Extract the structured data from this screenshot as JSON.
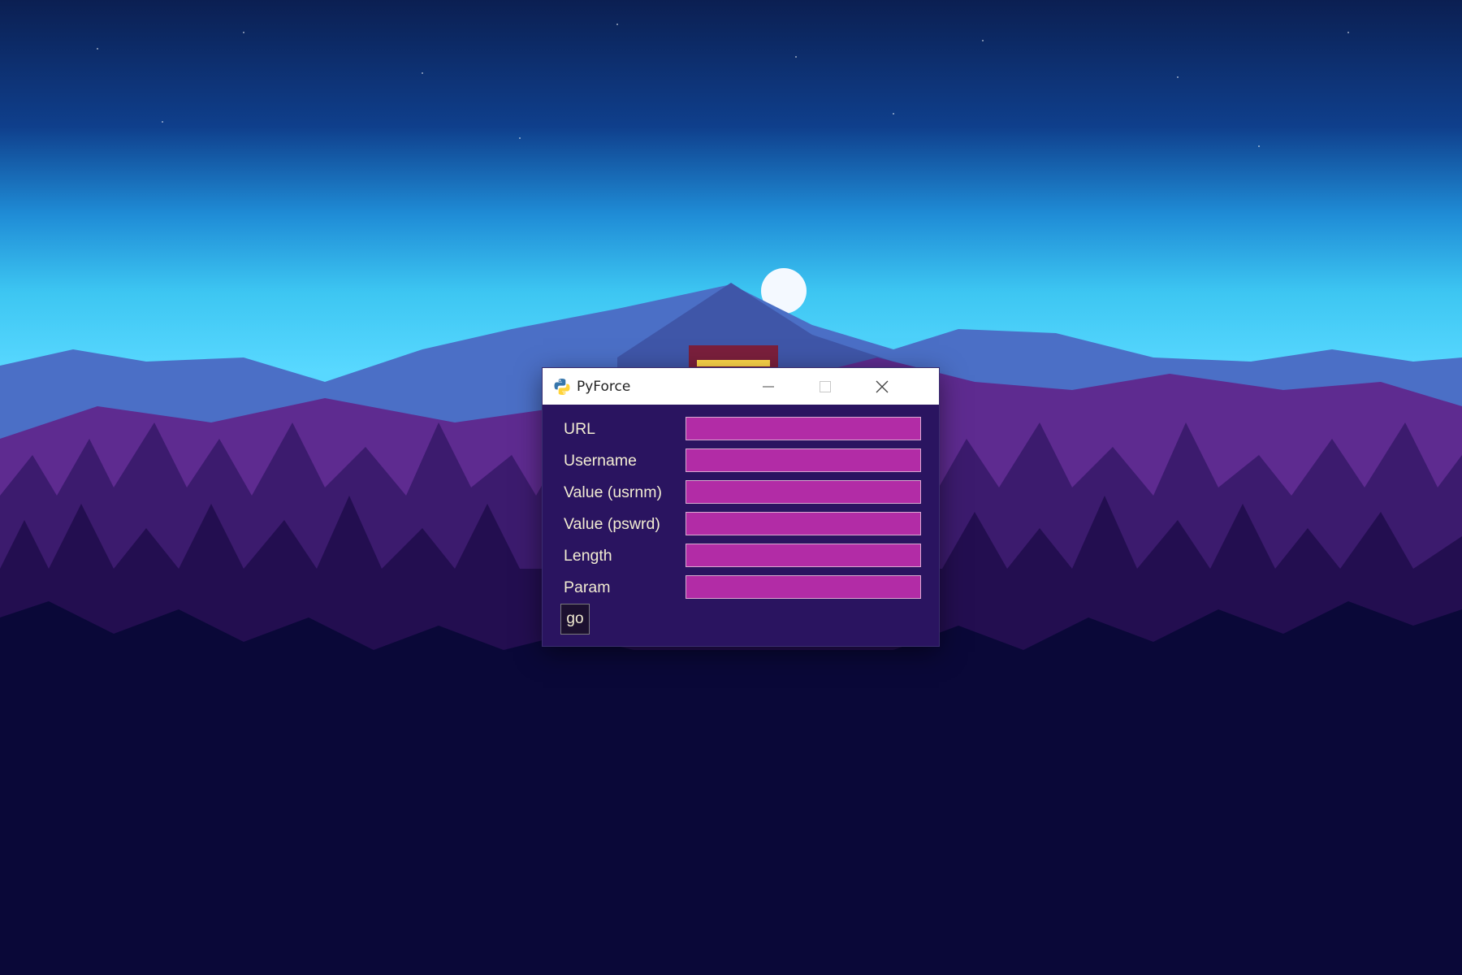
{
  "window": {
    "title": "PyForce",
    "icon": "python-logo-icon",
    "controls": [
      "minimize-icon",
      "maximize-icon",
      "close-icon"
    ]
  },
  "form": {
    "fields": [
      {
        "label": "URL",
        "value": ""
      },
      {
        "label": "Username",
        "value": ""
      },
      {
        "label": "Value (usrnm)",
        "value": ""
      },
      {
        "label": "Value (pswrd)",
        "value": ""
      },
      {
        "label": "Length",
        "value": ""
      },
      {
        "label": "Param",
        "value": ""
      }
    ],
    "submit_label": "go"
  },
  "colors": {
    "window_bg": "#2a1460",
    "field_bg": "#b22ca6",
    "label_text": "#f2ecd2",
    "titlebar_bg": "#ffffff"
  }
}
